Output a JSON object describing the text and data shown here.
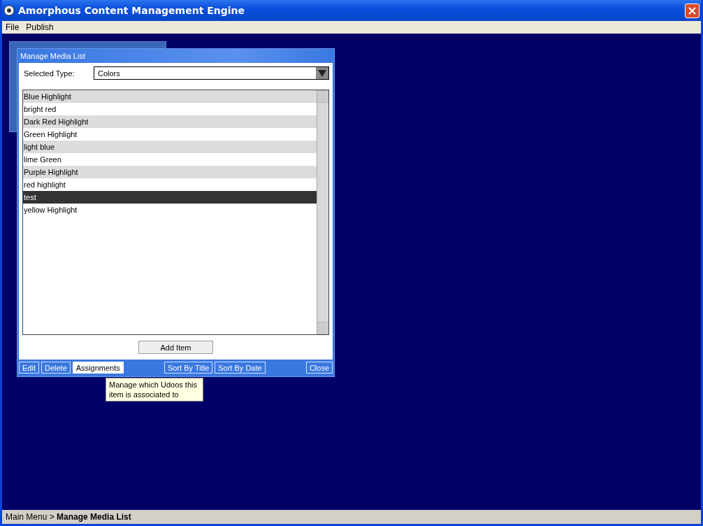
{
  "window": {
    "title": "Amorphous Content Management Engine"
  },
  "menu": [
    "File",
    "Publish"
  ],
  "dialog": {
    "title": "Manage Media List",
    "type_label": "Selected Type:",
    "type_value": "Colors",
    "items": [
      {
        "label": "Blue Highlight",
        "selected": false
      },
      {
        "label": "bright red",
        "selected": false
      },
      {
        "label": "Dark Red Highlight",
        "selected": false
      },
      {
        "label": "Green Highlight",
        "selected": false
      },
      {
        "label": "light blue",
        "selected": false
      },
      {
        "label": "lime Green",
        "selected": false
      },
      {
        "label": "Purple Highlight",
        "selected": false
      },
      {
        "label": "red highlight",
        "selected": false
      },
      {
        "label": "test",
        "selected": true
      },
      {
        "label": "yellow Highlight",
        "selected": false
      }
    ],
    "add_button": "Add Item",
    "left_buttons": [
      {
        "label": "Edit",
        "hovered": false
      },
      {
        "label": "Delete",
        "hovered": false
      },
      {
        "label": "Assignments",
        "hovered": true
      }
    ],
    "right_buttons": [
      {
        "label": "Sort By Title",
        "hovered": false
      },
      {
        "label": "Sort By Date",
        "hovered": false
      }
    ],
    "close_button": "Close",
    "tooltip": "Manage which Udoos this item is associated to"
  },
  "status_bar": "Main Menu > **Manage Media List**"
}
